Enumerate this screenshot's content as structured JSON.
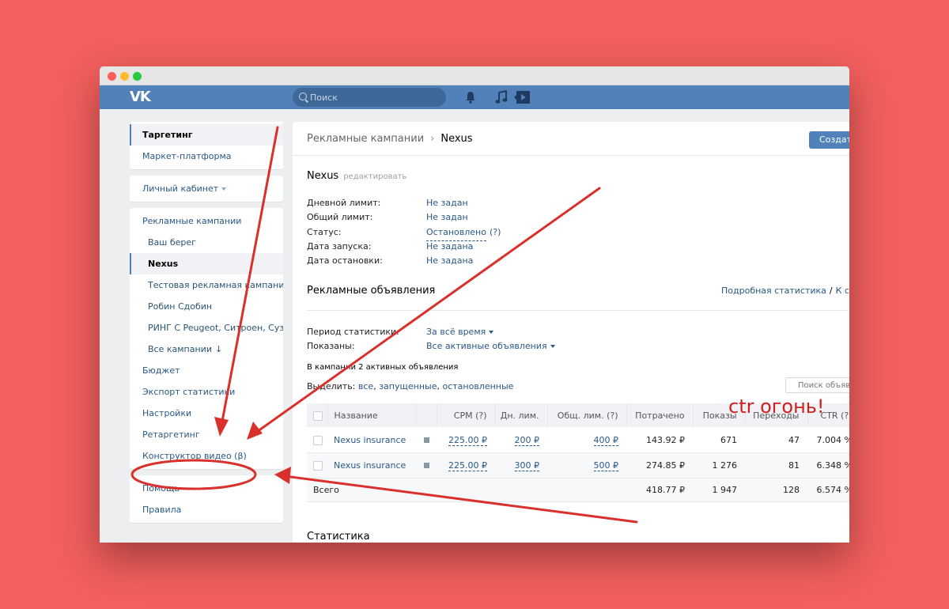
{
  "header": {
    "logo": "VK",
    "search_placeholder": "Поиск"
  },
  "sidebar": {
    "top": [
      "Таргетинг",
      "Маркет-платформа"
    ],
    "cabinet": "Личный кабинет",
    "campaigns_title": "Рекламные кампании",
    "campaigns": [
      "Ваш берег",
      "Nexus",
      "Тестовая рекламная кампания",
      "Робин Сдобин",
      "РИНГ С Peugeot, Ситроен, Сузуки",
      "Все кампании"
    ],
    "items": [
      "Бюджет",
      "Экспорт статистики",
      "Настройки",
      "Ретаргетинг",
      "Конструктор видео (β)"
    ],
    "bottom": [
      "Помощь",
      "Правила"
    ]
  },
  "breadcrumb": {
    "parent": "Рекламные кампании",
    "separator": "›",
    "current": "Nexus"
  },
  "create_button": "Создать",
  "campaign": {
    "name": "Nexus",
    "edit_label": "редактировать",
    "params": [
      {
        "label": "Дневной лимит:",
        "value": "Не задан"
      },
      {
        "label": "Общий лимит:",
        "value": "Не задан"
      },
      {
        "label": "Статус:",
        "value": "Остановлено",
        "extra": "(?)"
      },
      {
        "label": "Дата запуска:",
        "value": "Не задана"
      },
      {
        "label": "Дата остановки:",
        "value": "Не задана"
      }
    ]
  },
  "ads": {
    "title": "Рекламные объявления",
    "link_detailed": "Подробная статистика",
    "link_slash": "/",
    "link_stats": "К стат",
    "period_label": "Период статистики:",
    "period_value": "За всё время",
    "shown_label": "Показаны:",
    "shown_value": "Все активные объявления",
    "note": "В кампании 2 активных объявления",
    "select_prefix": "Выделить:",
    "select_all": "все",
    "select_running": "запущенные",
    "select_stopped": "остановленные",
    "search_placeholder": "Поиск объяв"
  },
  "table": {
    "headers": [
      "Название",
      "CPM (?)",
      "Дн. лим.",
      "Общ. лим. (?)",
      "Потрачено",
      "Показы",
      "Переходы",
      "CTR (?)"
    ],
    "rows": [
      {
        "name": "Nexus insurance",
        "cpm": "225.00 ₽",
        "day": "200 ₽",
        "total": "400 ₽",
        "spent": "143.92 ₽",
        "shows": "671",
        "clicks": "47",
        "ctr": "7.004 %"
      },
      {
        "name": "Nexus insurance",
        "cpm": "225.00 ₽",
        "day": "300 ₽",
        "total": "500 ₽",
        "spent": "274.85 ₽",
        "shows": "1 276",
        "clicks": "81",
        "ctr": "6.348 %"
      }
    ],
    "total": {
      "label": "Всего",
      "spent": "418.77 ₽",
      "shows": "1 947",
      "clicks": "128",
      "ctr": "6.574 %"
    }
  },
  "stats_title": "Статистика",
  "annotation": {
    "text": "ctr огонь!",
    "color": "#d9302b"
  },
  "colors": {
    "background": "#f25f5c",
    "vk_blue": "#5181b8",
    "link": "#2a5885"
  }
}
